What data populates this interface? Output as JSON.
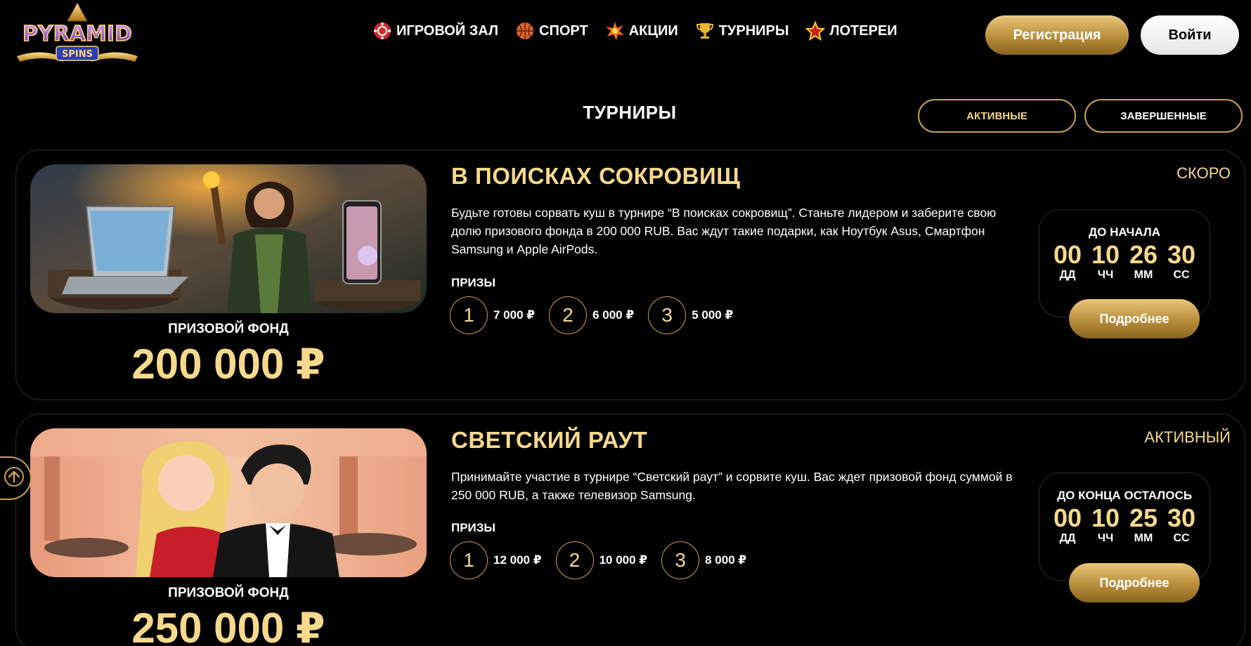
{
  "header": {
    "logo_text_top": "PYRAMID",
    "logo_text_bottom": "SPINS",
    "nav": [
      {
        "label": "ИГРОВОЙ ЗАЛ",
        "icon": "casino-chip-icon"
      },
      {
        "label": "СПОРТ",
        "icon": "basketball-icon"
      },
      {
        "label": "АКЦИИ",
        "icon": "burst-icon"
      },
      {
        "label": "ТУРНИРЫ",
        "icon": "trophy-icon"
      },
      {
        "label": "ЛОТЕРЕИ",
        "icon": "star-icon"
      }
    ],
    "register_label": "Регистрация",
    "login_label": "Войти"
  },
  "section": {
    "title": "ТУРНИРЫ",
    "tabs": {
      "active_label": "АКТИВНЫЕ",
      "finished_label": "ЗАВЕРШЕННЫЕ"
    }
  },
  "tournaments": [
    {
      "title": "В ПОИСКАХ СОКРОВИЩ",
      "status": "СКОРО",
      "description": "Будьте готовы сорвать куш в турнире “В поисках сокровищ”. Станьте лидером и заберите свою долю призового фонда в 200 000 RUB. Вас ждут такие подарки, как Ноутбук Asus, Смартфон Samsung и Apple AirPods.",
      "prizes_label": "ПРИЗЫ",
      "prizes": [
        {
          "place": "1",
          "amount": "7 000 ₽"
        },
        {
          "place": "2",
          "amount": "6 000 ₽"
        },
        {
          "place": "3",
          "amount": "5 000 ₽"
        }
      ],
      "fund_label": "ПРИЗОВОЙ ФОНД",
      "fund_value": "200 000 ₽",
      "timer_label": "ДО НАЧАЛА",
      "timer": {
        "dd": "00",
        "hh": "10",
        "mm": "26",
        "ss": "30"
      },
      "timer_units": {
        "dd": "ДД",
        "hh": "ЧЧ",
        "mm": "ММ",
        "ss": "СС"
      },
      "more_label": "Подробнее"
    },
    {
      "title": "СВЕТСКИЙ РАУТ",
      "status": "АКТИВНЫЙ",
      "description": "Принимайте участие в турнире “Светский раут” и сорвите куш. Вас ждет призовой фонд суммой в 250 000 RUB, а также телевизор Samsung.",
      "prizes_label": "ПРИЗЫ",
      "prizes": [
        {
          "place": "1",
          "amount": "12 000 ₽"
        },
        {
          "place": "2",
          "amount": "10 000 ₽"
        },
        {
          "place": "3",
          "amount": "8 000 ₽"
        }
      ],
      "fund_label": "ПРИЗОВОЙ ФОНД",
      "fund_value": "250 000 ₽",
      "timer_label": "ДО КОНЦА ОСТАЛОСЬ",
      "timer": {
        "dd": "00",
        "hh": "10",
        "mm": "25",
        "ss": "30"
      },
      "timer_units": {
        "dd": "ДД",
        "hh": "ЧЧ",
        "mm": "ММ",
        "ss": "СС"
      },
      "more_label": "Подробнее"
    }
  ],
  "colors": {
    "gold": "#f6d98c",
    "gold_border": "#c9a24f",
    "background": "#000000"
  }
}
